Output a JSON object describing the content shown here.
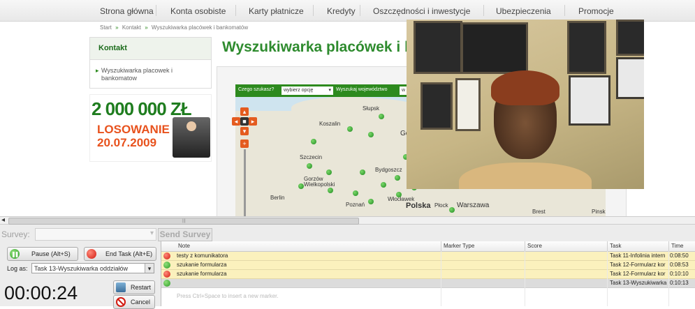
{
  "site": {
    "nav": [
      "Strona główna",
      "Konta osobiste",
      "Karty płatnicze",
      "Kredyty",
      "Oszczędności i inwestycje",
      "Ubezpieczenia",
      "Promocje"
    ],
    "breadcrumb": [
      "Start",
      "Kontakt",
      "Wyszukiwarka placówek i bankomatów"
    ],
    "sidebar": {
      "heading": "Kontakt",
      "link": "Wyszukiwarka placowek i bankomatow"
    },
    "promo": {
      "amount": "2 000 000 ZŁ",
      "line1": "LOSOWANIE",
      "line2": "20.07.2009"
    },
    "page_title": "Wyszukiwarka placówek i ban",
    "filter": {
      "label1": "Czego szukasz?",
      "select1": "wybierz opcję",
      "label2": "Wyszukaj województwo",
      "select2": "w"
    },
    "map_cities": [
      "Słupsk",
      "Koszalin",
      "Szczecin",
      "Bydgoszcz",
      "Gorzów Wielkopolski",
      "Berlin",
      "Poznań",
      "Włocławek",
      "Polska",
      "Płock",
      "Warszawa",
      "Brest",
      "Pinsk",
      "Go"
    ]
  },
  "recorder": {
    "survey_label": "Survey:",
    "survey_value": "",
    "send_survey": "Send Survey",
    "pause_label": "Pause (Alt+S)",
    "end_task_label": "End Task (Alt+E)",
    "log_as_label": "Log as:",
    "log_as_value": "Task 13-Wyszukiwarka oddziałów",
    "timer": "00:00:24",
    "restart_label": "Restart",
    "cancel_label": "Cancel",
    "columns": [
      "Note",
      "Marker Type",
      "Score",
      "Task",
      "Time"
    ],
    "rows": [
      {
        "status": "red",
        "note": "testy z komunikatora",
        "marker_type": "",
        "score": "",
        "task": "Task 11-Infolinia intern",
        "time": "0:08:50"
      },
      {
        "status": "green",
        "note": "szukanie formularza",
        "marker_type": "",
        "score": "",
        "task": "Task 12-Formularz kor",
        "time": "0:08:53"
      },
      {
        "status": "red",
        "note": "szukanie formularza",
        "marker_type": "",
        "score": "",
        "task": "Task 12-Formularz kor",
        "time": "0:10:10"
      },
      {
        "status": "green",
        "note": "",
        "marker_type": "",
        "score": "",
        "task": "Task 13-Wyszukiwarka",
        "time": "0:10:13"
      }
    ],
    "new_marker_hint": "Press Ctrl+Space to insert a new marker."
  }
}
